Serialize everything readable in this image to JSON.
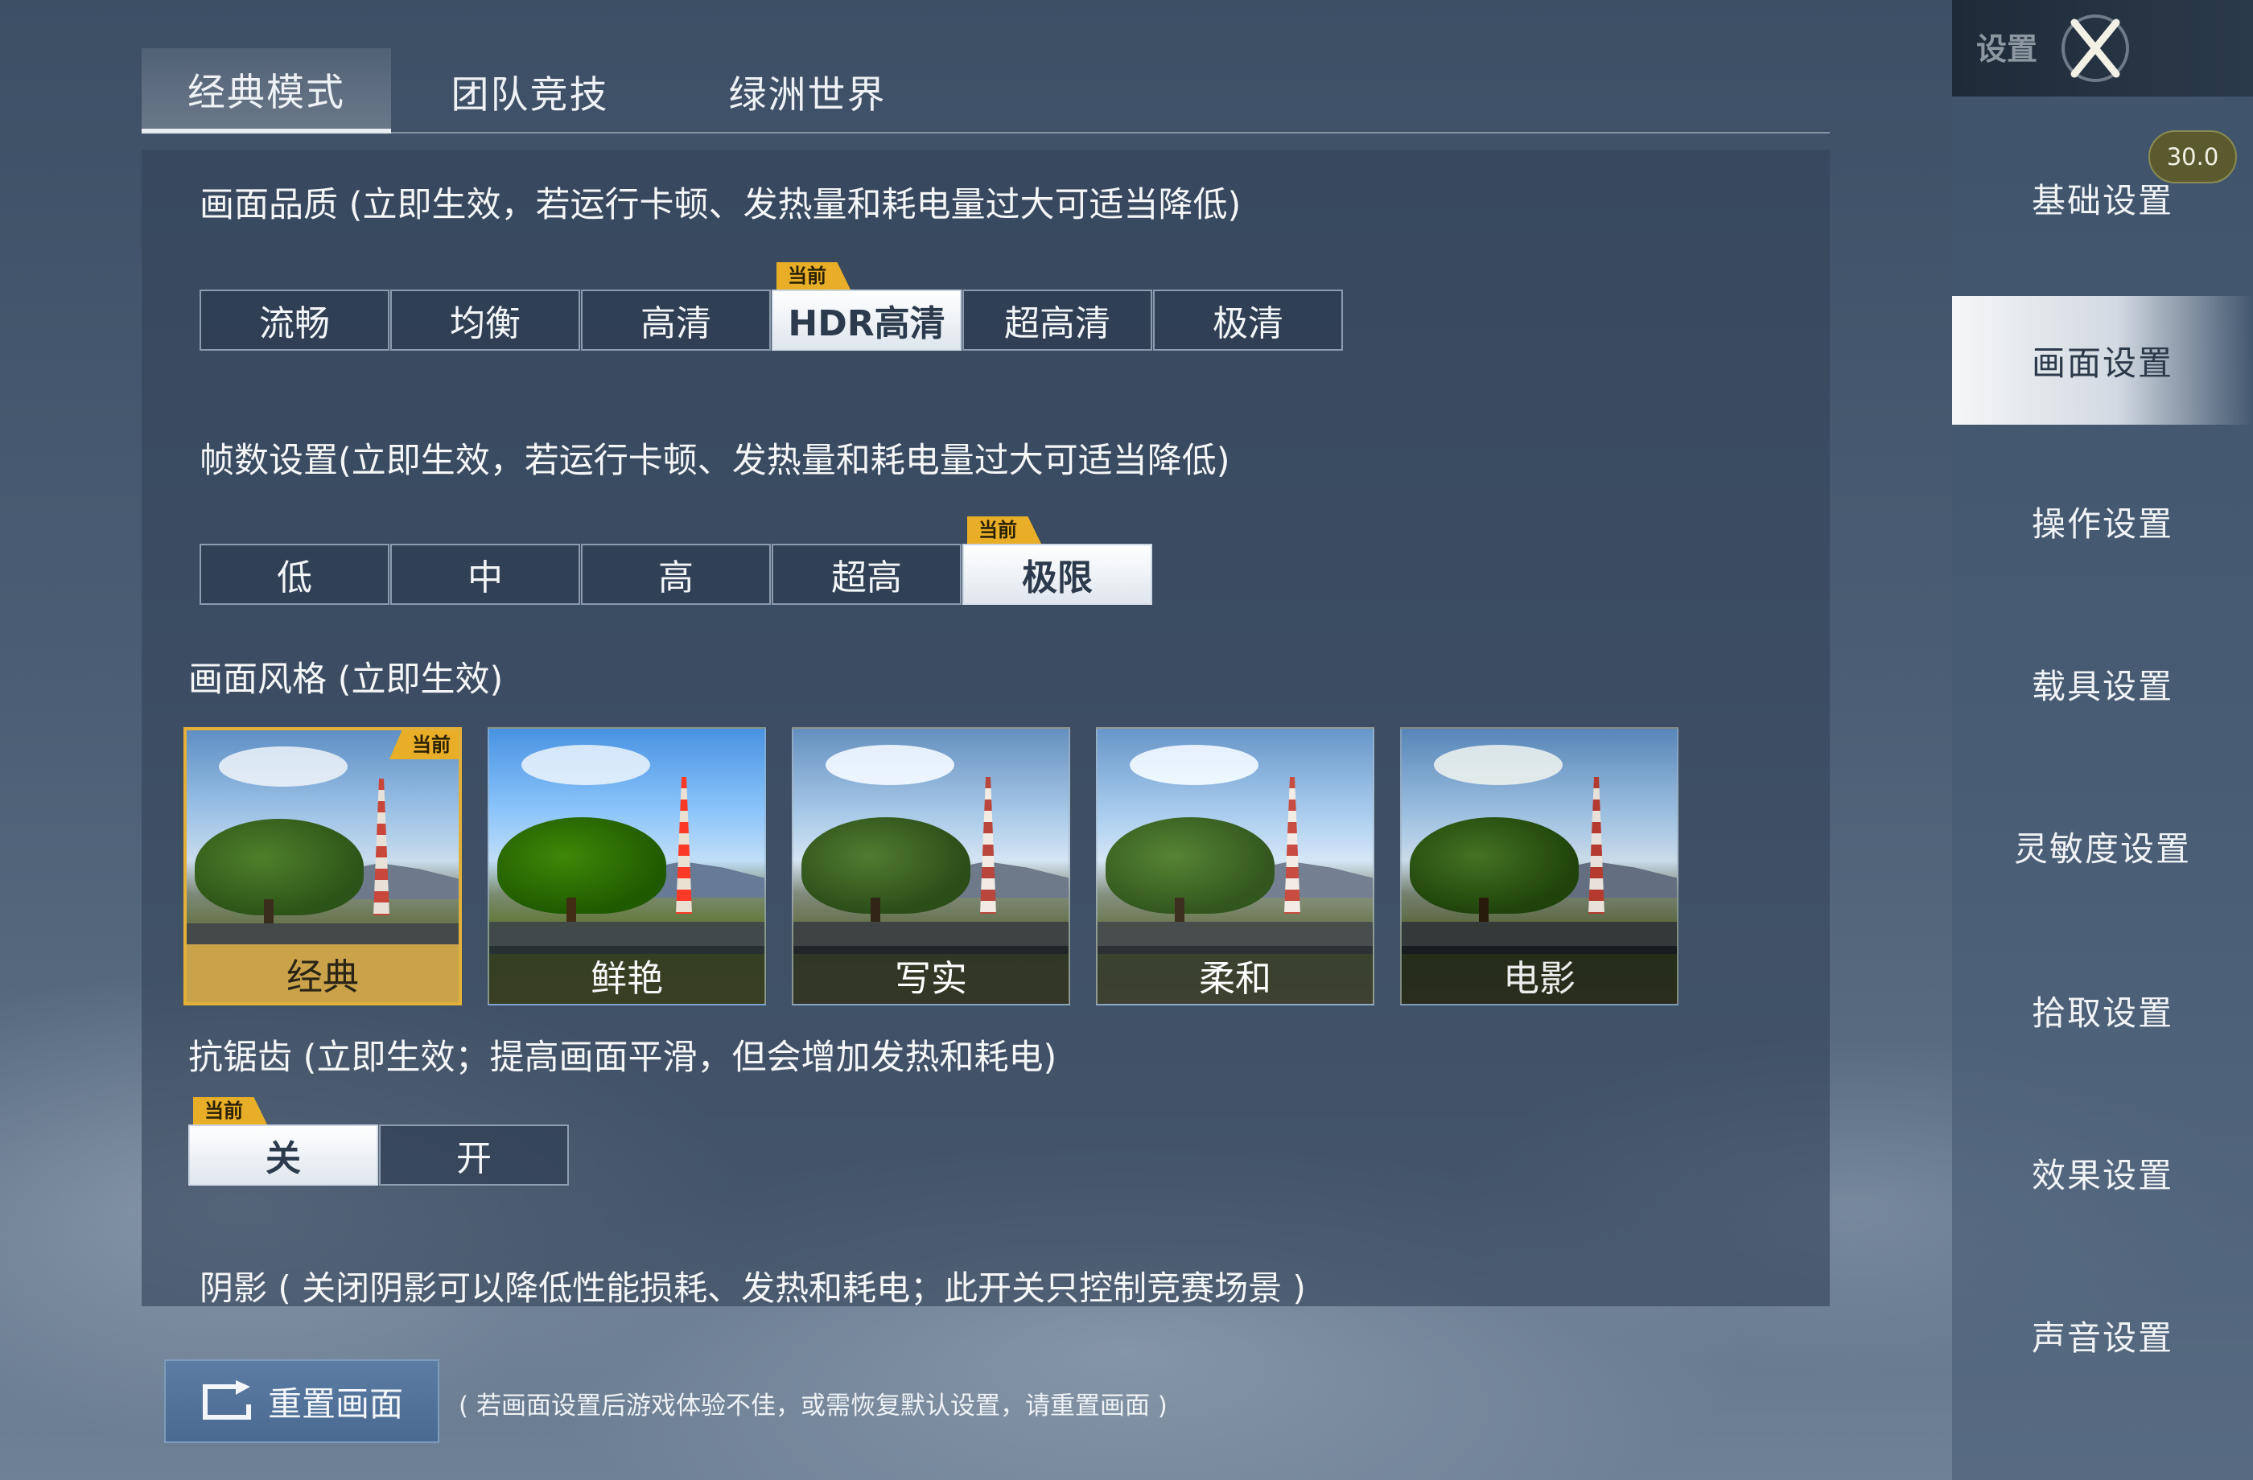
{
  "tabs": [
    {
      "label": "经典模式",
      "active": true
    },
    {
      "label": "团队竞技",
      "active": false
    },
    {
      "label": "绿洲世界",
      "active": false
    }
  ],
  "current_badge": "当前",
  "quality": {
    "title": "画面品质 (立即生效，若运行卡顿、发热量和耗电量过大可适当降低)",
    "options": [
      "流畅",
      "均衡",
      "高清",
      "HDR高清",
      "超高清",
      "极清"
    ],
    "selected": "HDR高清"
  },
  "fps": {
    "title": "帧数设置(立即生效，若运行卡顿、发热量和耗电量过大可适当降低)",
    "options": [
      "低",
      "中",
      "高",
      "超高",
      "极限"
    ],
    "selected": "极限"
  },
  "style": {
    "title": "画面风格 (立即生效)",
    "options": [
      "经典",
      "鲜艳",
      "写实",
      "柔和",
      "电影"
    ],
    "selected": "经典"
  },
  "antialias": {
    "title": "抗锯齿 (立即生效；提高画面平滑，但会增加发热和耗电)",
    "options": [
      "关",
      "开"
    ],
    "selected": "关"
  },
  "shadow": {
    "title": "阴影 ( 关闭阴影可以降低性能损耗、发热和耗电；此开关只控制竞赛场景 )"
  },
  "reset": {
    "button_label": "重置画面",
    "note": "( 若画面设置后游戏体验不佳，或需恢复默认设置，请重置画面 )"
  },
  "sidebar": {
    "title": "设置",
    "fps_value": "30.0",
    "items": [
      {
        "label": "基础设置",
        "active": false
      },
      {
        "label": "画面设置",
        "active": true
      },
      {
        "label": "操作设置",
        "active": false
      },
      {
        "label": "载具设置",
        "active": false
      },
      {
        "label": "灵敏度设置",
        "active": false
      },
      {
        "label": "拾取设置",
        "active": false
      },
      {
        "label": "效果设置",
        "active": false
      },
      {
        "label": "声音设置",
        "active": false
      }
    ]
  },
  "colors": {
    "badge": "#e8ae27",
    "selected_style_border": "#e3b13a"
  }
}
